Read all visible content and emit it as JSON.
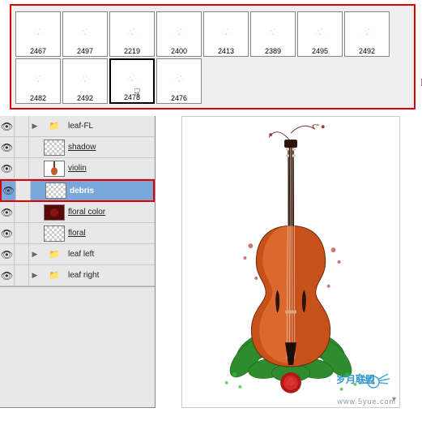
{
  "brushes": {
    "row1": [
      {
        "label": "2467"
      },
      {
        "label": "2497"
      },
      {
        "label": "2219"
      },
      {
        "label": "2400"
      },
      {
        "label": "2413"
      },
      {
        "label": "2389"
      },
      {
        "label": "2495"
      },
      {
        "label": "2492"
      }
    ],
    "row2": [
      {
        "label": "2482"
      },
      {
        "label": "2492"
      },
      {
        "label": "2478",
        "selected": true
      },
      {
        "label": "2476"
      }
    ],
    "side_char": "D"
  },
  "layers": [
    {
      "name": "leaf-FL",
      "type": "folder",
      "eye": true,
      "arrow": true,
      "link": false
    },
    {
      "name": "shadow",
      "type": "checker",
      "eye": true,
      "link": true
    },
    {
      "name": "violin",
      "type": "violin",
      "eye": true,
      "link": true
    },
    {
      "name": "debris",
      "type": "checker",
      "eye": true,
      "selected": true
    },
    {
      "name": "floral color",
      "type": "red",
      "eye": true,
      "link": true
    },
    {
      "name": "floral",
      "type": "checker",
      "eye": true,
      "link": true
    },
    {
      "name": "leaf left",
      "type": "folder",
      "eye": true,
      "arrow": true,
      "link": false
    },
    {
      "name": "leaf right",
      "type": "folder",
      "eye": true,
      "arrow": true,
      "link": false
    }
  ],
  "watermark": {
    "url": "www.5yue.com",
    "text": "岁月联盟"
  }
}
